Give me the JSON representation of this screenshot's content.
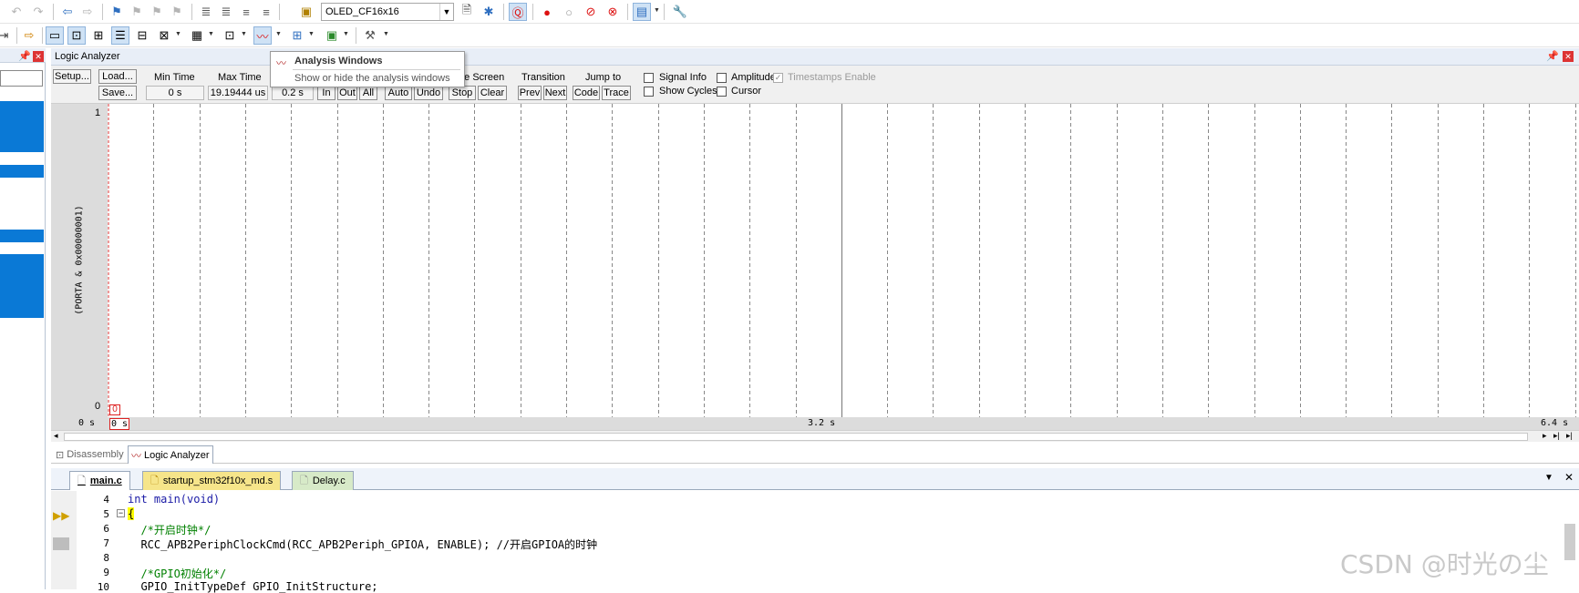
{
  "toolbar": {
    "target_combo": "OLED_CF16x16"
  },
  "logic_analyzer": {
    "title": "Logic Analyzer",
    "setup_label": "Setup...",
    "load_label": "Load...",
    "save_label": "Save...",
    "min_time_label": "Min Time",
    "max_time_label": "Max Time",
    "min_time_value": "0 s",
    "max_time_value": "19.19444 us",
    "grid_value": "0.2 s",
    "zoom_in": "In",
    "zoom_out": "Out",
    "zoom_all": "All",
    "auto": "Auto",
    "undo": "Undo",
    "update_screen_label": "ate Screen",
    "stop": "Stop",
    "clear": "Clear",
    "transition_label": "Transition",
    "prev": "Prev",
    "next": "Next",
    "jump_to_label": "Jump to",
    "code": "Code",
    "trace": "Trace",
    "signal_info": "Signal Info",
    "show_cycles": "Show Cycles",
    "amplitude": "Amplitude",
    "cursor": "Cursor",
    "timestamps_enable": "Timestamps Enable",
    "signal_name": "(PORTA & 0x00000001)",
    "y_max": "1",
    "y_min": "0",
    "value_marker": "0",
    "time_start": "0 s",
    "time_cursor": "0 s",
    "time_mid": "3.2 s",
    "time_end": "6.4 s"
  },
  "tooltip": {
    "title": "Analysis Windows",
    "description": "Show or hide the analysis windows"
  },
  "window_tabs": {
    "disassembly": "Disassembly",
    "logic_analyzer": "Logic Analyzer"
  },
  "file_tabs": {
    "main": "main.c",
    "startup": "startup_stm32f10x_md.s",
    "delay": "Delay.c"
  },
  "editor": {
    "lines": [
      {
        "num": "4",
        "text": "int main(void)"
      },
      {
        "num": "5",
        "text": "{"
      },
      {
        "num": "6",
        "text": "  /*开启时钟*/"
      },
      {
        "num": "7",
        "text": "  RCC_APB2PeriphClockCmd(RCC_APB2Periph_GPIOA, ENABLE); //开启GPIOA的时钟"
      },
      {
        "num": "8",
        "text": ""
      },
      {
        "num": "9",
        "text": "  /*GPIO初始化*/"
      },
      {
        "num": "10",
        "text": "  GPIO_InitTypeDef GPIO_InitStructure;"
      }
    ]
  },
  "watermark": "CSDN @时光の尘"
}
